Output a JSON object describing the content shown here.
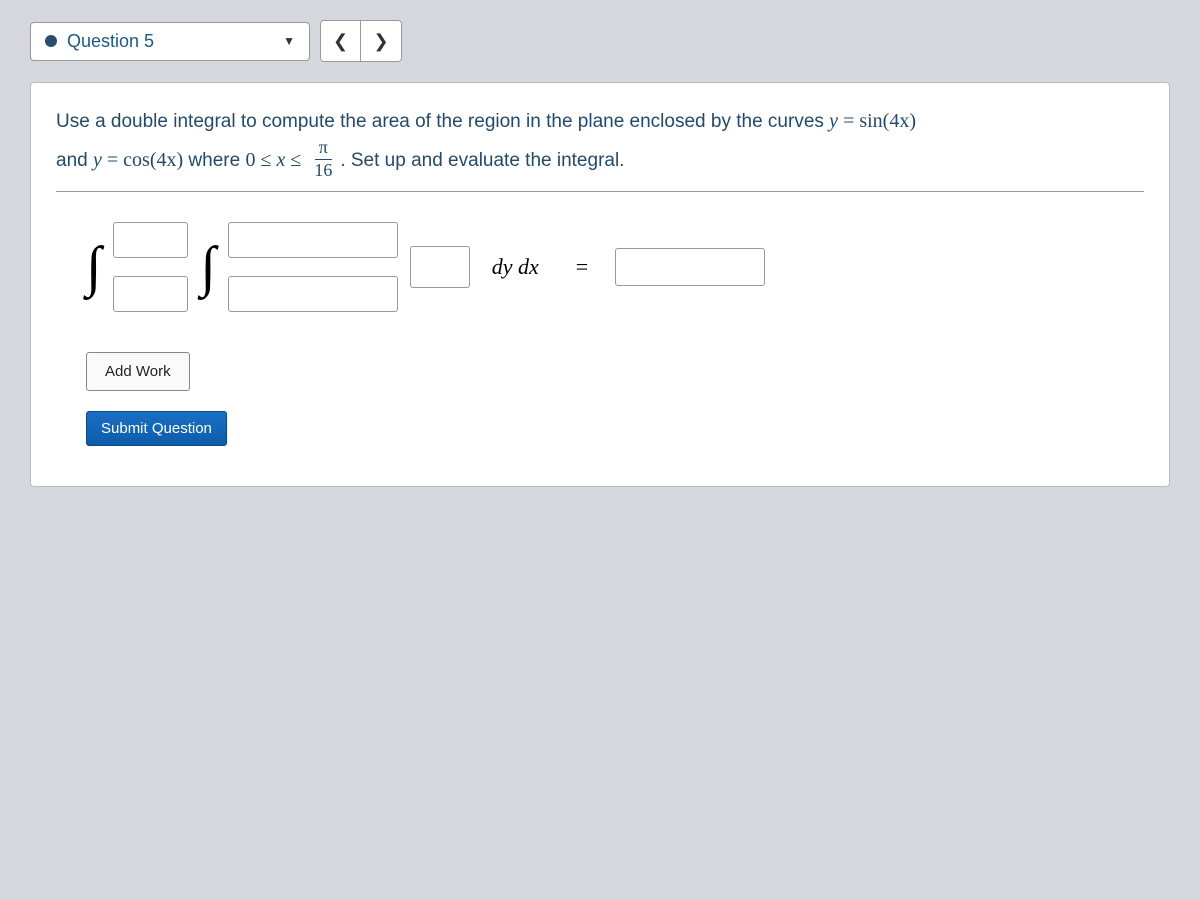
{
  "header": {
    "question_label": "Question 5"
  },
  "question": {
    "line1_part1": "Use a double integral to compute the area of the region in the plane enclosed by the curves ",
    "line1_eq1_lhs": "y",
    "line1_eq1_op": " = ",
    "line1_eq1_rhs": "sin(4x)",
    "line2_part1": "and ",
    "line2_eq2_lhs": "y",
    "line2_eq2_op": " = ",
    "line2_eq2_rhs": "cos(4x)",
    "line2_part2": " where ",
    "line2_range_low": "0",
    "line2_range_op1": " ≤ ",
    "line2_range_var": "x",
    "line2_range_op2": " ≤ ",
    "line2_frac_num": "π",
    "line2_frac_den": "16",
    "line2_part3": ". Set up and evaluate the integral."
  },
  "integral": {
    "differential": "dy dx",
    "equals": "="
  },
  "buttons": {
    "add_work": "Add Work",
    "submit": "Submit Question"
  }
}
